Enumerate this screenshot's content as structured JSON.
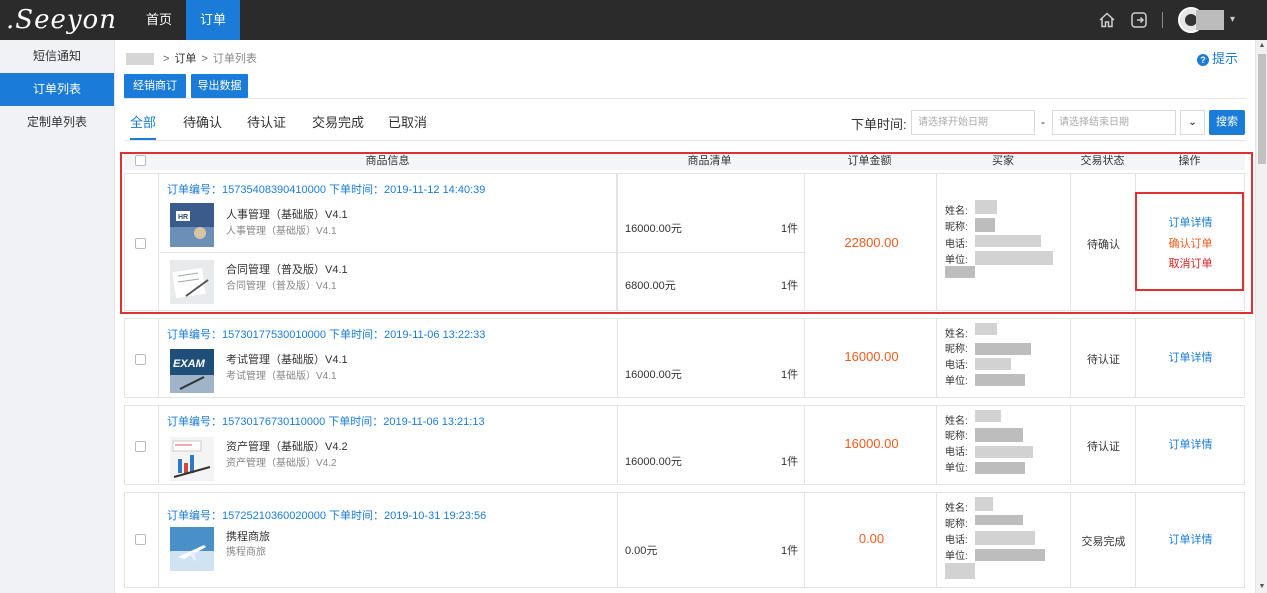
{
  "header": {
    "logo": ".Seeyon",
    "nav": [
      {
        "label": "首页"
      },
      {
        "label": "订单"
      }
    ]
  },
  "sidebar": {
    "items": [
      {
        "label": "短信通知"
      },
      {
        "label": "订单列表"
      },
      {
        "label": "定制单列表"
      }
    ]
  },
  "breadcrumb": {
    "sep": ">",
    "level2": "订单",
    "current": "订单列表"
  },
  "tip": {
    "label": "提示",
    "icon": "?"
  },
  "toolbar": {
    "dealer_order": "经销商订单",
    "export": "导出数据"
  },
  "tabs": [
    {
      "label": "全部"
    },
    {
      "label": "待确认"
    },
    {
      "label": "待认证"
    },
    {
      "label": "交易完成"
    },
    {
      "label": "已取消"
    }
  ],
  "filter": {
    "label": "下单时间:",
    "start_placeholder": "请选择开始日期",
    "dash": "-",
    "end_placeholder": "请选择结束日期",
    "dropdown_icon": "⌄",
    "search": "搜索"
  },
  "table": {
    "headers": [
      "商品信息",
      "商品清单",
      "订单金额",
      "买家",
      "交易状态",
      "操作"
    ],
    "buyer_labels": [
      "姓名:",
      "昵称:",
      "电话:",
      "单位:"
    ],
    "orders": [
      {
        "head": "订单编号：15735408390410000 下单时间：2019-11-12 14:40:39",
        "products": [
          {
            "name": "人事管理（基础版）V4.1",
            "sub": "人事管理（基础版）V4.1",
            "price": "16000.00元",
            "qty": "1件"
          },
          {
            "name": "合同管理（普及版）V4.1",
            "sub": "合同管理（普及版）V4.1",
            "price": "6800.00元",
            "qty": "1件"
          }
        ],
        "amount": "22800.00",
        "status": "待确认",
        "ops": [
          "订单详情",
          "确认订单",
          "取消订单"
        ]
      },
      {
        "head": "订单编号：15730177530010000 下单时间：2019-11-06 13:22:33",
        "products": [
          {
            "name": "考试管理（基础版）V4.1",
            "sub": "考试管理（基础版）V4.1",
            "price": "16000.00元",
            "qty": "1件"
          }
        ],
        "amount": "16000.00",
        "status": "待认证",
        "ops": [
          "订单详情"
        ]
      },
      {
        "head": "订单编号：15730176730110000 下单时间：2019-11-06 13:21:13",
        "products": [
          {
            "name": "资产管理（基础版）V4.2",
            "sub": "资产管理（基础版）V4.2",
            "price": "16000.00元",
            "qty": "1件"
          }
        ],
        "amount": "16000.00",
        "status": "待认证",
        "ops": [
          "订单详情"
        ]
      },
      {
        "head": "订单编号：15725210360020000 下单时间：2019-10-31 19:23:56",
        "products": [
          {
            "name": "携程商旅",
            "sub": "携程商旅",
            "price": "0.00元",
            "qty": "1件"
          }
        ],
        "amount": "0.00",
        "status": "交易完成",
        "ops": [
          "订单详情"
        ]
      }
    ]
  },
  "colors": {
    "accent": "#1a7cd8",
    "topbar": "#2b2b2b",
    "amount": "#f25b1d",
    "cancel": "#e02020",
    "highlight_box": "#e03030"
  }
}
